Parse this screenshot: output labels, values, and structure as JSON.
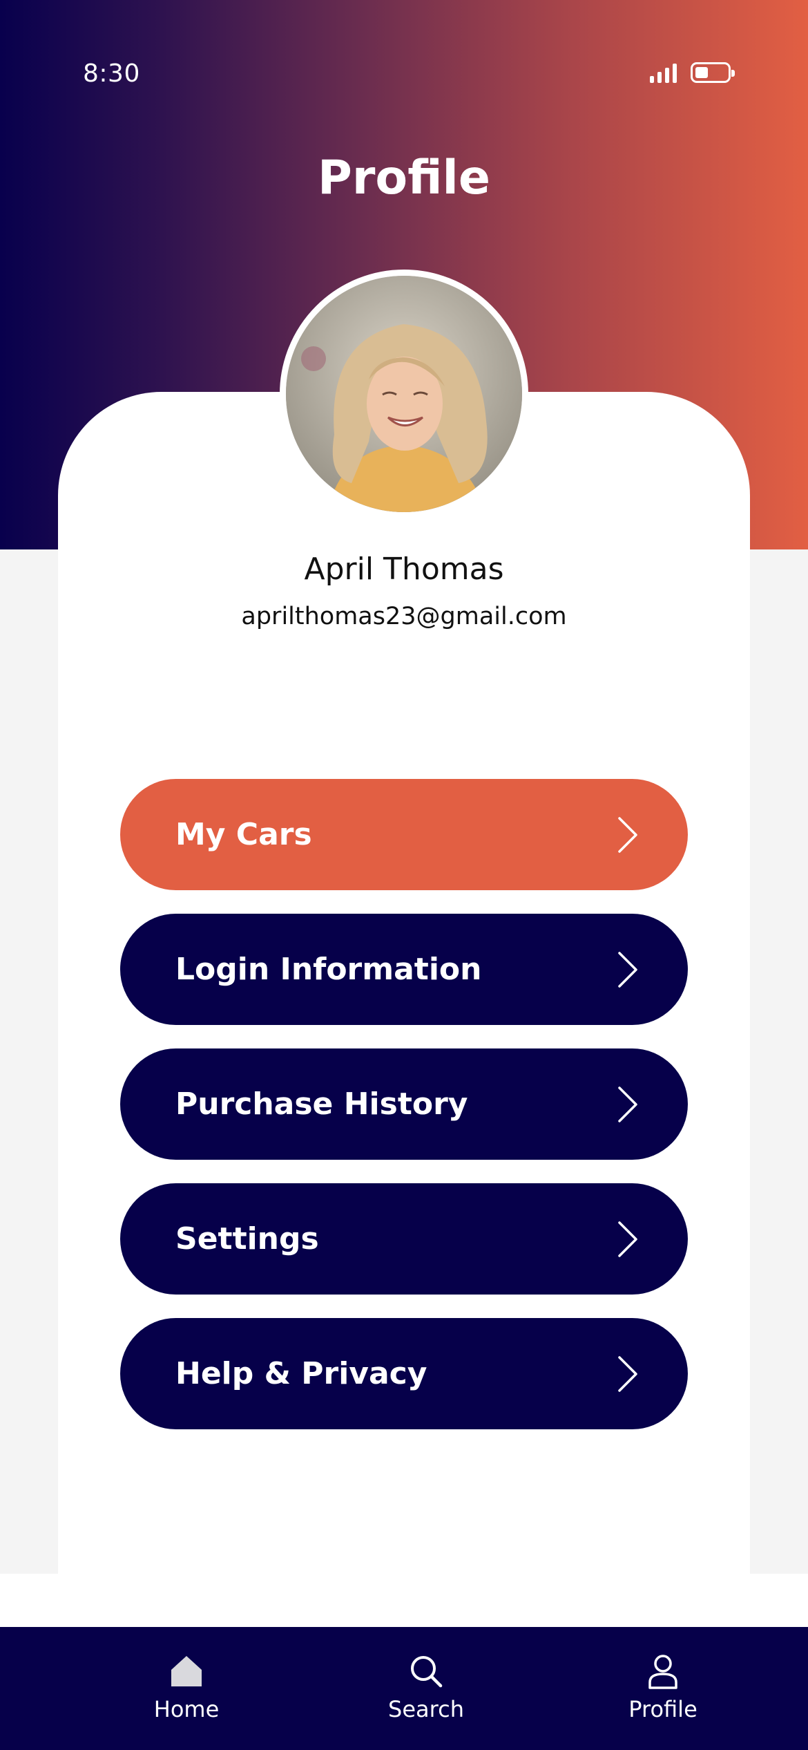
{
  "status_bar": {
    "time": "8:30",
    "signal_icon": "signal-icon",
    "battery_icon": "battery-icon"
  },
  "header": {
    "title": "Profile"
  },
  "profile": {
    "name": "April Thomas",
    "email": "aprilthomas23@gmail.com"
  },
  "menu": {
    "items": [
      {
        "label": "My Cars"
      },
      {
        "label": "Login Information"
      },
      {
        "label": "Purchase History"
      },
      {
        "label": "Settings"
      },
      {
        "label": "Help & Privacy"
      }
    ]
  },
  "nav": {
    "items": [
      {
        "label": "Home",
        "icon": "home-icon"
      },
      {
        "label": "Search",
        "icon": "search-icon"
      },
      {
        "label": "Profile",
        "icon": "profile-icon"
      }
    ]
  },
  "colors": {
    "navy": "#06004a",
    "accent": "#e25f43",
    "gradient_start": "#08004d",
    "gradient_end": "#e25f43"
  }
}
